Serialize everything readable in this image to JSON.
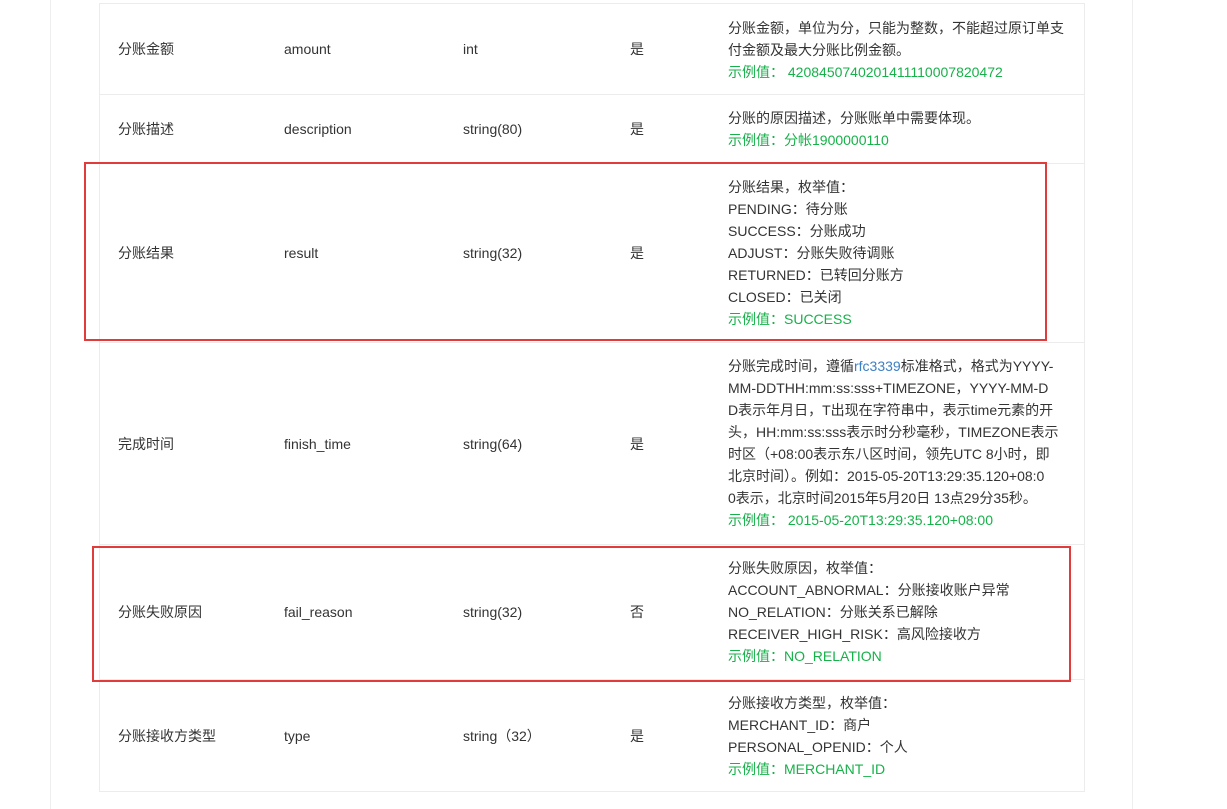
{
  "rows": [
    {
      "name": "分账金额",
      "field": "amount",
      "type": "int",
      "required": "是",
      "desc_lines": [
        "分账金额，单位为分，只能为整数，不能超过原订单支",
        "付金额及最大分账比例金额。"
      ],
      "example": "示例值： 4208450740201411110007820472"
    },
    {
      "name": "分账描述",
      "field": "description",
      "type": "string(80)",
      "required": "是",
      "desc_lines": [
        "分账的原因描述，分账账单中需要体现。"
      ],
      "example": "示例值：分帐1900000110"
    },
    {
      "name": "分账结果",
      "field": "result",
      "type": "string(32)",
      "required": "是",
      "desc_lines": [
        "分账结果，枚举值：",
        "PENDING：待分账",
        "SUCCESS：分账成功",
        "ADJUST：分账失败待调账",
        "RETURNED：已转回分账方",
        "CLOSED：已关闭"
      ],
      "example": "示例值：SUCCESS"
    },
    {
      "name": "完成时间",
      "field": "finish_time",
      "type": "string(64)",
      "required": "是",
      "desc_first_pre": "分账完成时间，遵循",
      "desc_first_link": "rfc3339",
      "desc_first_post": "标准格式，格式为YYYY-",
      "desc_lines": [
        "MM-DDTHH:mm:ss:sss+TIMEZONE，YYYY-MM-D",
        "D表示年月日，T出现在字符串中，表示time元素的开",
        "头，HH:mm:ss:sss表示时分秒毫秒，TIMEZONE表示",
        "时区（+08:00表示东八区时间，领先UTC 8小时，即",
        "北京时间）。例如：2015-05-20T13:29:35.120+08:0",
        "0表示，北京时间2015年5月20日 13点29分35秒。"
      ],
      "example": "示例值： 2015-05-20T13:29:35.120+08:00"
    },
    {
      "name": "分账失败原因",
      "field": "fail_reason",
      "type": "string(32)",
      "required": "否",
      "desc_lines": [
        "分账失败原因，枚举值：",
        "ACCOUNT_ABNORMAL：分账接收账户异常",
        "NO_RELATION：分账关系已解除",
        "RECEIVER_HIGH_RISK：高风险接收方"
      ],
      "example": "示例值：NO_RELATION"
    },
    {
      "name": "分账接收方类型",
      "field": "type",
      "type": "string（32）",
      "required": "是",
      "desc_lines": [
        "分账接收方类型，枚举值：",
        "MERCHANT_ID：商户",
        "PERSONAL_OPENID：个人"
      ],
      "example": "示例值：MERCHANT_ID"
    }
  ],
  "colors": {
    "highlight": "#e03c3c",
    "example": "#17b14a",
    "link": "#3d7fc4"
  }
}
